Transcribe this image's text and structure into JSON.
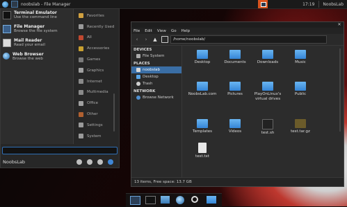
{
  "top_panel": {
    "window_title": "noobslab - File Manager",
    "clock": "17:19",
    "user": "NoobsLab"
  },
  "start_menu": {
    "apps": [
      {
        "name": "Terminal Emulator",
        "desc": "Use the command line",
        "icon": "terminal-icon"
      },
      {
        "name": "File Manager",
        "desc": "Browse the file system",
        "icon": "file-manager-icon"
      },
      {
        "name": "Mail Reader",
        "desc": "Read your email",
        "icon": "mail-icon"
      },
      {
        "name": "Web Browser",
        "desc": "Browse the web",
        "icon": "web-browser-icon"
      }
    ],
    "categories": [
      {
        "label": "Favorites",
        "color": "#d0a040"
      },
      {
        "label": "Recently Used",
        "color": "#9a9a9a"
      },
      {
        "label": "All",
        "color": "#c04830"
      },
      {
        "label": "Accessories",
        "color": "#c8a030"
      },
      {
        "label": "Games",
        "color": "#7a7a7a"
      },
      {
        "label": "Graphics",
        "color": "#a0a0a0"
      },
      {
        "label": "Internet",
        "color": "#8a8a8a"
      },
      {
        "label": "Multimedia",
        "color": "#8a8a8a"
      },
      {
        "label": "Office",
        "color": "#a0a0a0"
      },
      {
        "label": "Other",
        "color": "#b06030"
      },
      {
        "label": "Settings",
        "color": "#9a9a9a"
      },
      {
        "label": "System",
        "color": "#9a9a9a"
      }
    ],
    "search_value": "",
    "footer_user": "NoobsLab"
  },
  "file_manager": {
    "menu": [
      "File",
      "Edit",
      "View",
      "Go",
      "Help"
    ],
    "path": "/home/noobslab/",
    "sidebar": {
      "devices_header": "DEVICES",
      "devices": [
        "File System"
      ],
      "places_header": "PLACES",
      "places": [
        "noobslab",
        "Desktop",
        "Trash"
      ],
      "network_header": "NETWORK",
      "network": [
        "Browse Network"
      ]
    },
    "items": [
      {
        "label": "Desktop",
        "kind": "folder"
      },
      {
        "label": "Documents",
        "kind": "folder"
      },
      {
        "label": "Downloads",
        "kind": "folder"
      },
      {
        "label": "Music",
        "kind": "folder"
      },
      {
        "label": "NoobsLab.com",
        "kind": "folder"
      },
      {
        "label": "Pictures",
        "kind": "folder"
      },
      {
        "label": "PlayOnLinux's virtual drives",
        "kind": "folder"
      },
      {
        "label": "Public",
        "kind": "folder"
      },
      {
        "label": "Templates",
        "kind": "folder"
      },
      {
        "label": "Videos",
        "kind": "folder"
      },
      {
        "label": "test.sh",
        "kind": "file-sh"
      },
      {
        "label": "test.tar.gz",
        "kind": "file-tar"
      },
      {
        "label": "test.txt",
        "kind": "file-txt"
      }
    ],
    "status": "13 items, Free space: 13.7 GB"
  },
  "dock": [
    "files-icon",
    "terminal-icon",
    "documents-icon",
    "web-browser-icon",
    "search-icon",
    "folder-icon"
  ]
}
